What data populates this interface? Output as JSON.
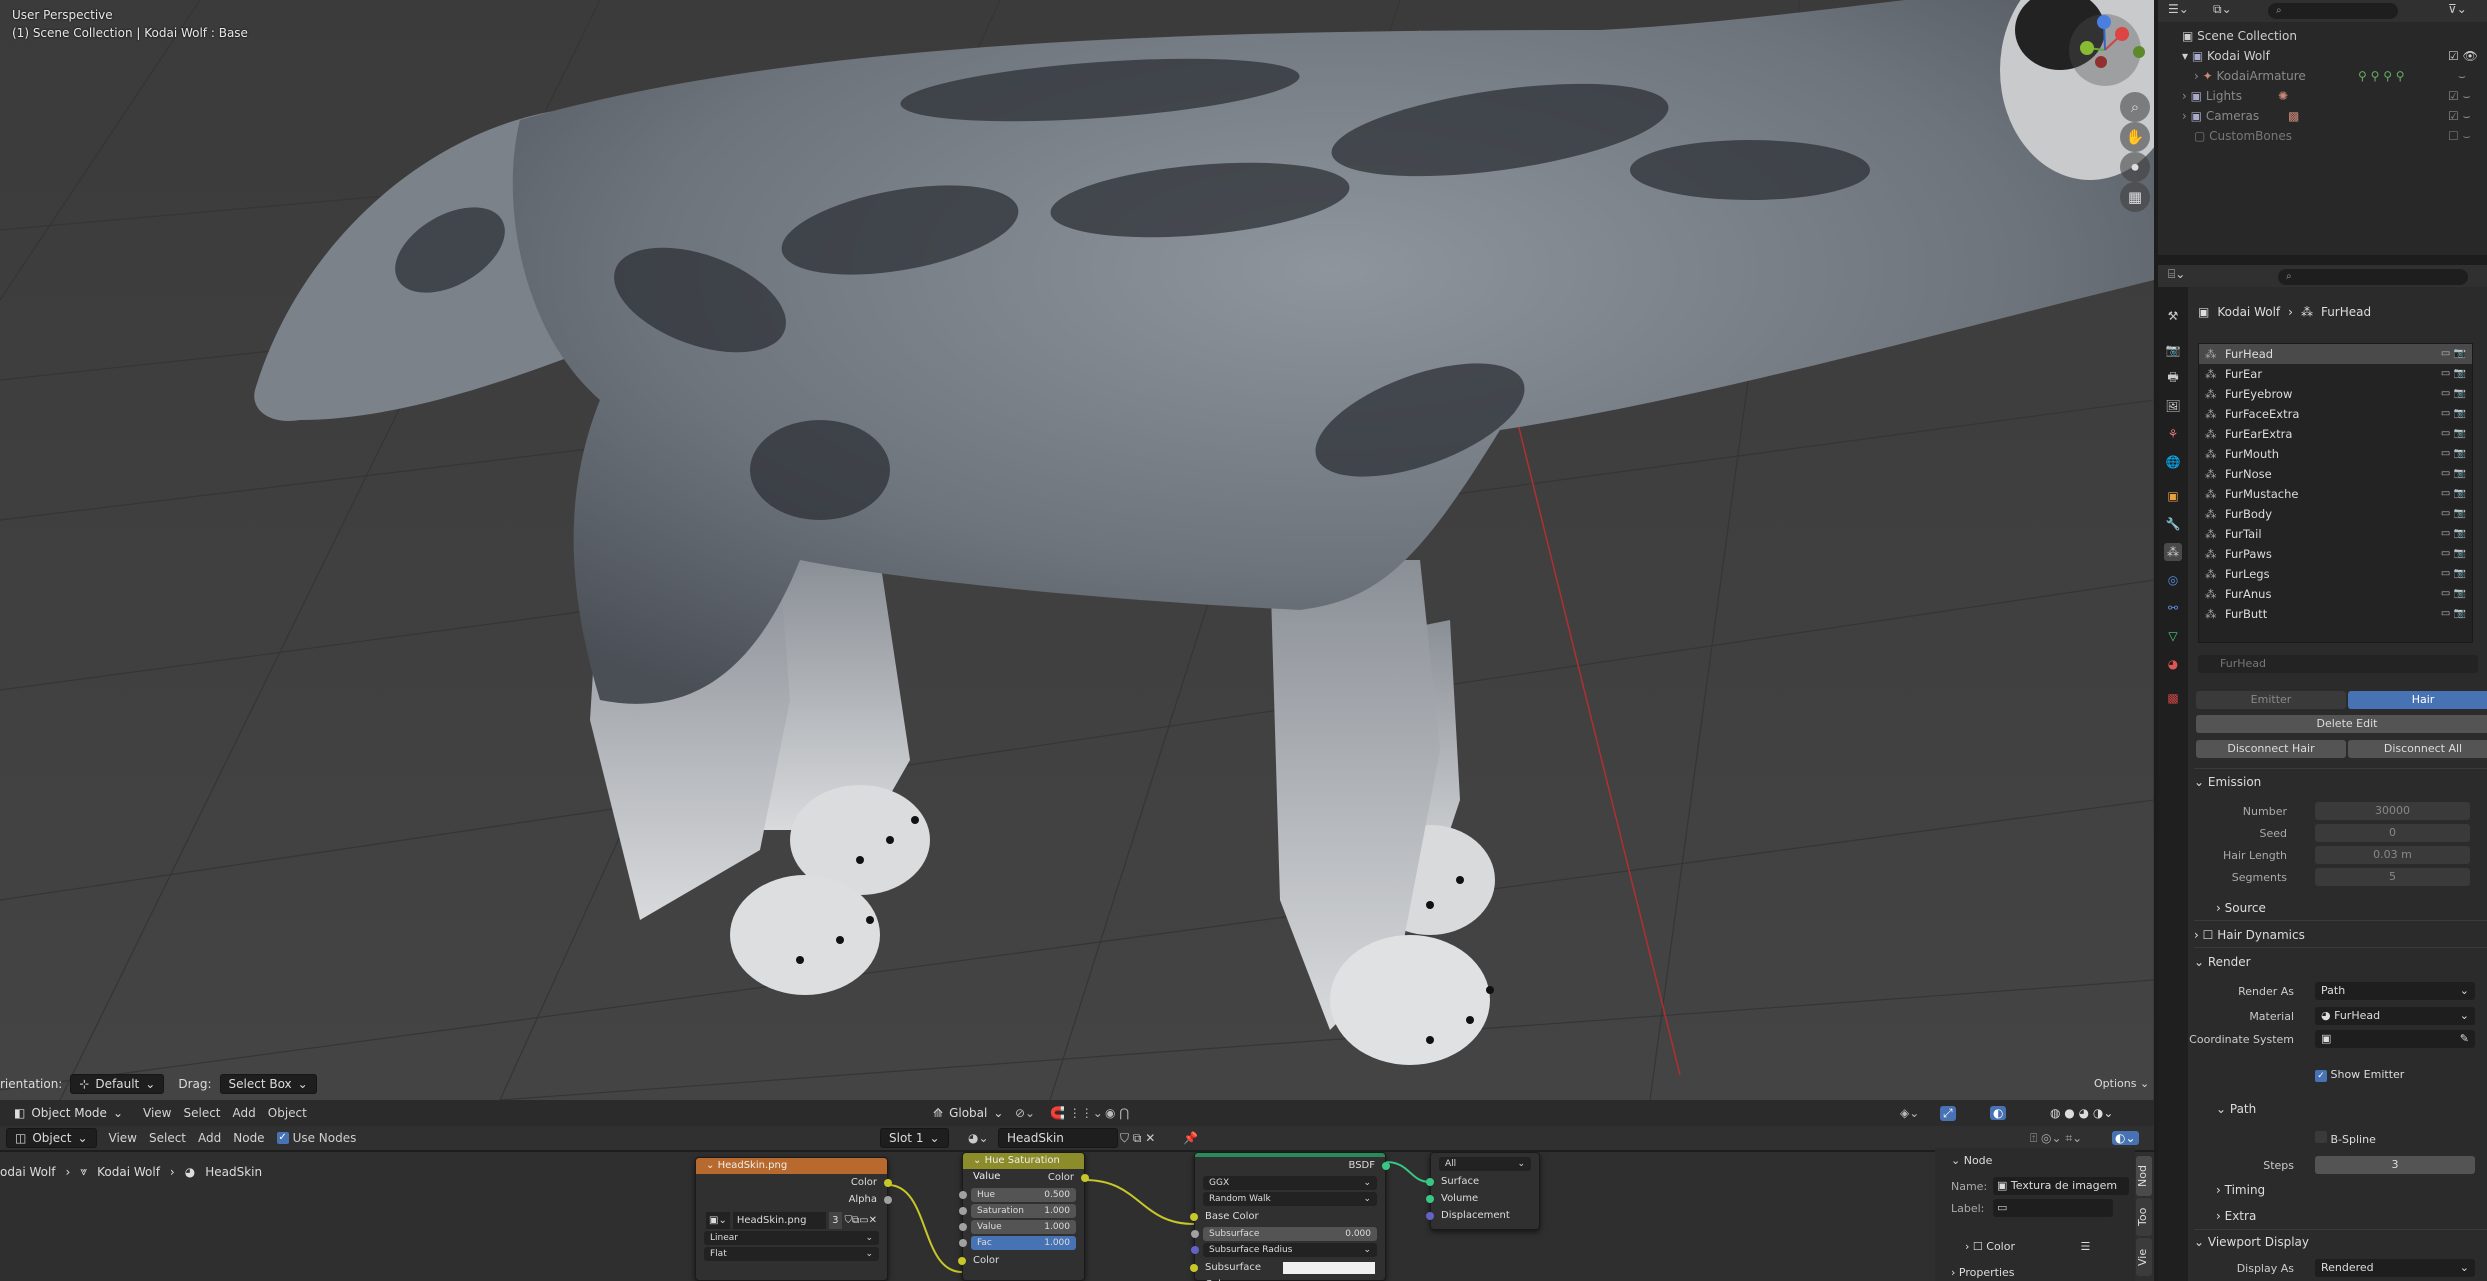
{
  "viewport": {
    "line1": "User Perspective",
    "line2": "(1) Scene Collection | Kodai Wolf : Base",
    "options_label": "Options"
  },
  "viewport_header": {
    "orientation_label": "rientation:",
    "orientation_value": "Default",
    "drag_label": "Drag:",
    "drag_value": "Select Box"
  },
  "viewport_menu": {
    "mode": "Object Mode",
    "items": [
      "View",
      "Select",
      "Add",
      "Object"
    ],
    "transform": "Global"
  },
  "node_header": {
    "mode": "Object",
    "items": [
      "View",
      "Select",
      "Add",
      "Node"
    ],
    "use_nodes": "Use Nodes",
    "slot": "Slot 1",
    "material": "HeadSkin"
  },
  "breadcrumb": {
    "items": [
      "odai Wolf",
      "Kodai Wolf",
      "HeadSkin"
    ]
  },
  "nodes": {
    "image": {
      "title": "HeadSkin.png",
      "out1": "Color",
      "out2": "Alpha",
      "file": "HeadSkin.png",
      "users": "3",
      "interp": "Linear",
      "proj": "Flat",
      "color": "#b86a2e"
    },
    "hsv": {
      "title": "Hue Saturation Value",
      "out": "Color",
      "hue_label": "Hue",
      "hue_value": "0.500",
      "sat_label": "Saturation",
      "sat_value": "1.000",
      "val_label": "Value",
      "val_value": "1.000",
      "fac_label": "Fac",
      "fac_value": "1.000",
      "in": "Color",
      "color": "#8c8c2a"
    },
    "bsdf": {
      "out": "BSDF",
      "dist": "GGX",
      "sss": "Random Walk",
      "base_color": "Base Color",
      "subsurface": "Subsurface",
      "subsurface_value": "0.000",
      "ss_radius": "Subsurface Radius",
      "ss_color": "Subsurface Color"
    },
    "output": {
      "target": "All",
      "surface": "Surface",
      "volume": "Volume",
      "displacement": "Displacement"
    }
  },
  "node_panel": {
    "section": "Node",
    "name_label": "Name:",
    "name_value": "Textura de imagem",
    "label_label": "Label:",
    "color_section": "Color",
    "properties_section": "Properties",
    "tabs": [
      "Nod",
      "Too",
      "Vie"
    ]
  },
  "outliner": {
    "root": "Scene Collection",
    "items": [
      {
        "label": "Kodai Wolf",
        "dim": false
      },
      {
        "label": "KodaiArmature",
        "dim": true
      },
      {
        "label": "Lights",
        "dim": true
      },
      {
        "label": "Cameras",
        "dim": true
      },
      {
        "label": "CustomBones",
        "dim": true
      }
    ]
  },
  "properties": {
    "breadcrumb_object": "Kodai Wolf",
    "breadcrumb_system": "FurHead",
    "systems": [
      "FurHead",
      "FurEar",
      "FurEyebrow",
      "FurFaceExtra",
      "FurEarExtra",
      "FurMouth",
      "FurNose",
      "FurMustache",
      "FurBody",
      "FurTail",
      "FurPaws",
      "FurLegs",
      "FurAnus",
      "FurButt"
    ],
    "settings_name": "FurHead",
    "type_emitter": "Emitter",
    "type_hair": "Hair",
    "delete_edit": "Delete Edit",
    "disconnect_hair": "Disconnect Hair",
    "disconnect_all": "Disconnect All",
    "emission": {
      "title": "Emission",
      "number_label": "Number",
      "number": "30000",
      "seed_label": "Seed",
      "seed": "0",
      "length_label": "Hair Length",
      "length": "0.03 m",
      "segments_label": "Segments",
      "segments": "5"
    },
    "source": "Source",
    "hair_dynamics": "Hair Dynamics",
    "render": {
      "title": "Render",
      "render_as_label": "Render As",
      "render_as": "Path",
      "material_label": "Material",
      "material": "FurHead",
      "coord_label": "Coordinate System",
      "show_emitter": "Show Emitter"
    },
    "path": {
      "title": "Path",
      "bspline": "B-Spline",
      "steps_label": "Steps",
      "steps": "3"
    },
    "timing": "Timing",
    "extra": "Extra",
    "viewport_display": {
      "title": "Viewport Display",
      "display_as_label": "Display As",
      "display_as": "Rendered"
    }
  }
}
